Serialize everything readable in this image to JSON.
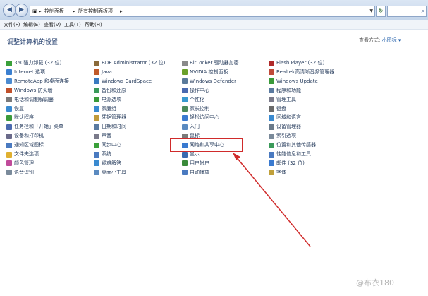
{
  "address_bar": {
    "path_root": "控制面板",
    "path_current": "所有控制面板项"
  },
  "menu": [
    "文件(F)",
    "编辑(E)",
    "查看(V)",
    "工具(T)",
    "帮助(H)"
  ],
  "page_title": "调整计算机的设置",
  "view_by": {
    "label": "查看方式:",
    "value": "小图标 ▾"
  },
  "columns": [
    [
      {
        "label": "360强力卸载 (32 位)",
        "icon": "uninstall-icon",
        "color": "#3aa03a"
      },
      {
        "label": "Internet 选项",
        "icon": "internet-icon",
        "color": "#3a7fd0"
      },
      {
        "label": "RemoteApp 和桌面连接",
        "icon": "remoteapp-icon",
        "color": "#4a8ad0"
      },
      {
        "label": "Windows 防火墙",
        "icon": "firewall-icon",
        "color": "#c0502a"
      },
      {
        "label": "电话和调制解调器",
        "icon": "phone-icon",
        "color": "#7a7a7a"
      },
      {
        "label": "恢复",
        "icon": "recovery-icon",
        "color": "#3a8ad0"
      },
      {
        "label": "默认程序",
        "icon": "default-programs-icon",
        "color": "#3a9a3a"
      },
      {
        "label": "任务栏和「开始」菜单",
        "icon": "taskbar-icon",
        "color": "#4a6ab0"
      },
      {
        "label": "设备和打印机",
        "icon": "printer-icon",
        "color": "#6a6a8a"
      },
      {
        "label": "通知区域图标",
        "icon": "notify-icon",
        "color": "#4a7ac0"
      },
      {
        "label": "文件夹选项",
        "icon": "folder-icon",
        "color": "#e0b030"
      },
      {
        "label": "颜色管理",
        "icon": "color-icon",
        "color": "#c04a9a"
      },
      {
        "label": "语音识别",
        "icon": "speech-icon",
        "color": "#7a8a9a"
      }
    ],
    [
      {
        "label": "BDE Administrator (32 位)",
        "icon": "bde-icon",
        "color": "#8a6a3a"
      },
      {
        "label": "Java",
        "icon": "java-icon",
        "color": "#c05a2a"
      },
      {
        "label": "Windows CardSpace",
        "icon": "cardspace-icon",
        "color": "#3a7ac0"
      },
      {
        "label": "备份和还原",
        "icon": "backup-icon",
        "color": "#3a9a5a"
      },
      {
        "label": "电源选项",
        "icon": "power-icon",
        "color": "#3a9a3a"
      },
      {
        "label": "家庭组",
        "icon": "homegroup-icon",
        "color": "#3a8ad0"
      },
      {
        "label": "凭据管理器",
        "icon": "credential-icon",
        "color": "#c09a3a"
      },
      {
        "label": "日期和时间",
        "icon": "clock-icon",
        "color": "#5a7aa0"
      },
      {
        "label": "声音",
        "icon": "sound-icon",
        "color": "#7a7a8a"
      },
      {
        "label": "同步中心",
        "icon": "sync-icon",
        "color": "#3aa03a"
      },
      {
        "label": "系统",
        "icon": "system-icon",
        "color": "#4a7ac0"
      },
      {
        "label": "疑难解答",
        "icon": "troubleshoot-icon",
        "color": "#3a8ad0"
      },
      {
        "label": "桌面小工具",
        "icon": "gadget-icon",
        "color": "#5a8ac0"
      }
    ],
    [
      {
        "label": "BitLocker 驱动器加密",
        "icon": "bitlocker-icon",
        "color": "#8a8a8a"
      },
      {
        "label": "NVIDIA 控制面板",
        "icon": "nvidia-icon",
        "color": "#6aa02a"
      },
      {
        "label": "Windows Defender",
        "icon": "defender-icon",
        "color": "#5a7a9a"
      },
      {
        "label": "操作中心",
        "icon": "action-center-icon",
        "color": "#4a6ab0"
      },
      {
        "label": "个性化",
        "icon": "personalize-icon",
        "color": "#3a9ad0"
      },
      {
        "label": "家长控制",
        "icon": "parental-icon",
        "color": "#4a8a5a"
      },
      {
        "label": "轻松访问中心",
        "icon": "ease-access-icon",
        "color": "#3a7ad0"
      },
      {
        "label": "入门",
        "icon": "getting-started-icon",
        "color": "#5a8ac0"
      },
      {
        "label": "鼠标",
        "icon": "mouse-icon",
        "color": "#7a7a7a"
      },
      {
        "label": "网络和共享中心",
        "icon": "network-icon",
        "color": "#3a7ad0"
      },
      {
        "label": "显示",
        "icon": "display-icon",
        "color": "#3a6ab0"
      },
      {
        "label": "用户帐户",
        "icon": "user-accounts-icon",
        "color": "#3a8a3a"
      },
      {
        "label": "自动播放",
        "icon": "autoplay-icon",
        "color": "#4a7ac0"
      }
    ],
    [
      {
        "label": "Flash Player (32 位)",
        "icon": "flash-icon",
        "color": "#b02a2a"
      },
      {
        "label": "Realtek高清晰音频管理器",
        "icon": "realtek-icon",
        "color": "#c04a3a"
      },
      {
        "label": "Windows Update",
        "icon": "windows-update-icon",
        "color": "#3a9a3a"
      },
      {
        "label": "程序和功能",
        "icon": "programs-icon",
        "color": "#5a7aa0"
      },
      {
        "label": "管理工具",
        "icon": "admin-tools-icon",
        "color": "#7a7a8a"
      },
      {
        "label": "键盘",
        "icon": "keyboard-icon",
        "color": "#6a6a6a"
      },
      {
        "label": "区域和语言",
        "icon": "region-icon",
        "color": "#3a8ad0"
      },
      {
        "label": "设备管理器",
        "icon": "device-manager-icon",
        "color": "#6a7a8a"
      },
      {
        "label": "索引选项",
        "icon": "indexing-icon",
        "color": "#7a8a9a"
      },
      {
        "label": "位置和其他传感器",
        "icon": "location-icon",
        "color": "#3a9a5a"
      },
      {
        "label": "性能信息和工具",
        "icon": "performance-icon",
        "color": "#4a7ac0"
      },
      {
        "label": "邮件 (32 位)",
        "icon": "mail-icon",
        "color": "#3a7ad0"
      },
      {
        "label": "字体",
        "icon": "font-icon",
        "color": "#c0a03a"
      }
    ]
  ],
  "highlight_color": "#d02b2b",
  "watermark": "@布衣180"
}
